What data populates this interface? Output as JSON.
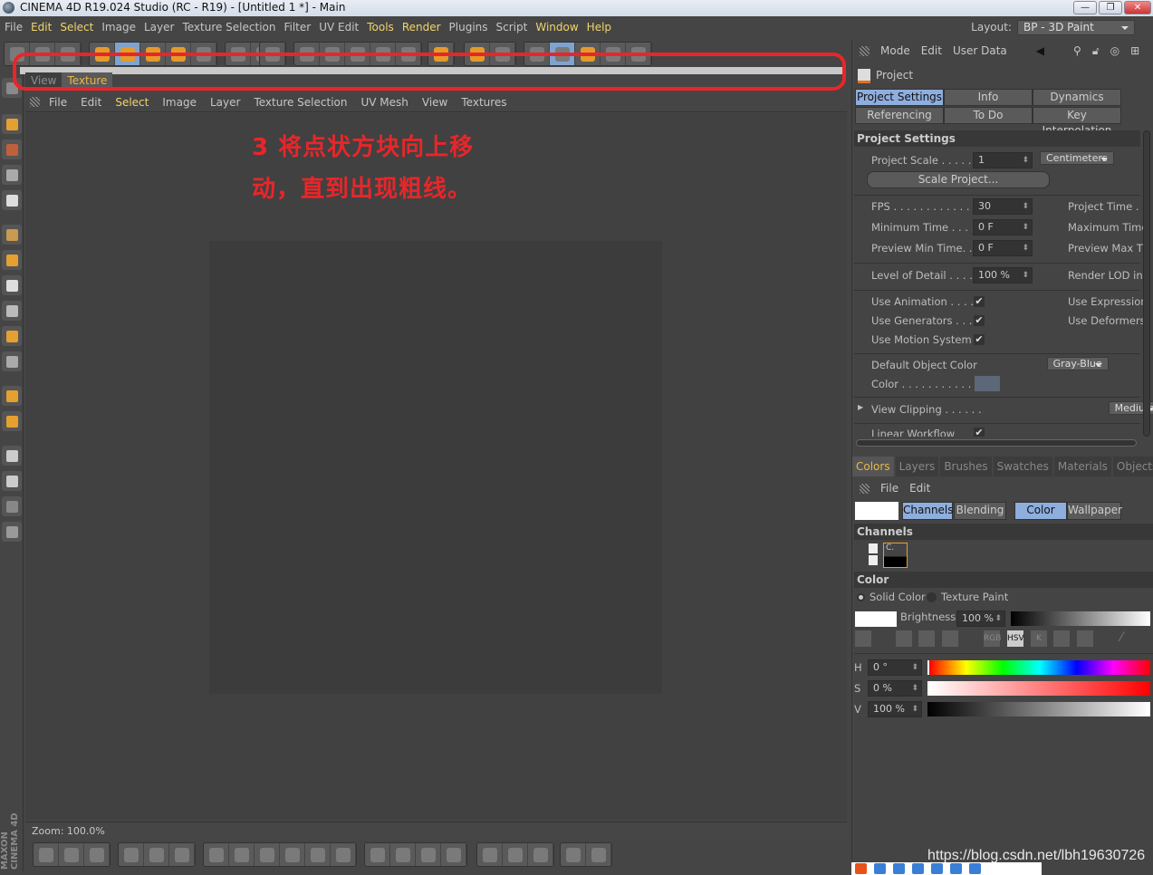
{
  "window": {
    "title": "CINEMA 4D R19.024 Studio (RC - R19) - [Untitled 1 *] - Main",
    "controls": [
      "—",
      "❐",
      "✕"
    ]
  },
  "menu": [
    "File",
    "Edit",
    "Select",
    "Image",
    "Layer",
    "Texture Selection",
    "Filter",
    "UV Edit",
    "Tools",
    "Render",
    "Plugins",
    "Script",
    "Window",
    "Help"
  ],
  "menu_highlight": [
    "Edit",
    "Select",
    "Tools",
    "Render",
    "Window",
    "Help"
  ],
  "layout": {
    "label": "Layout:",
    "value": "BP - 3D Paint"
  },
  "view_tabs": [
    {
      "label": "View",
      "active": false
    },
    {
      "label": "Texture",
      "active": true
    }
  ],
  "texture_menu": [
    "File",
    "Edit",
    "Select",
    "Image",
    "Layer",
    "Texture Selection",
    "UV Mesh",
    "View",
    "Textures"
  ],
  "annotation": {
    "line1": "3  将点状方块向上移",
    "line2": "动，直到出现粗线。",
    "color": "#e8262a"
  },
  "status": {
    "zoom": "Zoom: 100.0%"
  },
  "brand": "MAXON CINEMA 4D",
  "attributes": {
    "menu": [
      "Mode",
      "Edit",
      "User Data"
    ],
    "object": "Project",
    "tabs": [
      [
        "Project Settings",
        "Info",
        "Dynamics"
      ],
      [
        "Referencing",
        "To Do",
        "Key Interpolation"
      ]
    ],
    "section": "Project Settings",
    "project_scale": {
      "label": "Project Scale . . . . . . .",
      "value": "1",
      "unit": "Centimeters"
    },
    "scale_button": "Scale Project...",
    "fps": {
      "label": "FPS . . . . . . . . . . . . . . .",
      "value": "30",
      "right": "Project Time . ."
    },
    "min_time": {
      "label": "Minimum Time . . . . .",
      "value": "0 F",
      "right": "Maximum Time"
    },
    "preview_min": {
      "label": "Preview Min Time. . .",
      "value": "0 F",
      "right": "Preview Max Ti"
    },
    "lod": {
      "label": "Level of Detail . . . . . .",
      "value": "100 %",
      "right": "Render LOD in"
    },
    "use_animation": {
      "label": "Use Animation . . . . .",
      "checked": true,
      "right": "Use Expression"
    },
    "use_generators": {
      "label": "Use Generators . . . . .",
      "checked": true,
      "right": "Use Deformers"
    },
    "use_motion": {
      "label": "Use Motion System",
      "checked": true
    },
    "default_color": {
      "label": "Default Object Color",
      "value": "Gray-Blue"
    },
    "color": {
      "label": "Color . . . . . . . . . . .",
      "swatch": "#5c6878"
    },
    "view_clipping": {
      "label": "View Clipping . . . . . .",
      "value": "Medium"
    },
    "linear_workflow": {
      "label": "Linear Workflow",
      "checked": true
    },
    "check": "✔"
  },
  "colors_panel": {
    "tabs": [
      "Colors",
      "Layers",
      "Brushes",
      "Swatches",
      "Materials",
      "Objects"
    ],
    "menu": [
      "File",
      "Edit"
    ],
    "mode_buttons": [
      {
        "label": "Channels",
        "on": true
      },
      {
        "label": "Blending",
        "on": false
      },
      {
        "label": "Color",
        "on": true
      },
      {
        "label": "Wallpaper",
        "on": false
      }
    ],
    "channels_title": "Channels",
    "channel_label": "C.",
    "color_title": "Color",
    "solid": "Solid Color",
    "texture_paint": "Texture Paint",
    "brightness": {
      "label": "Brightness",
      "value": "100 %"
    },
    "modes": [
      "RGB",
      "HSV",
      "K"
    ],
    "h": {
      "label": "H",
      "value": "0 °"
    },
    "s": {
      "label": "S",
      "value": "0 %"
    },
    "v": {
      "label": "V",
      "value": "100 %"
    }
  },
  "watermark": "https://blog.csdn.net/lbh19630726"
}
